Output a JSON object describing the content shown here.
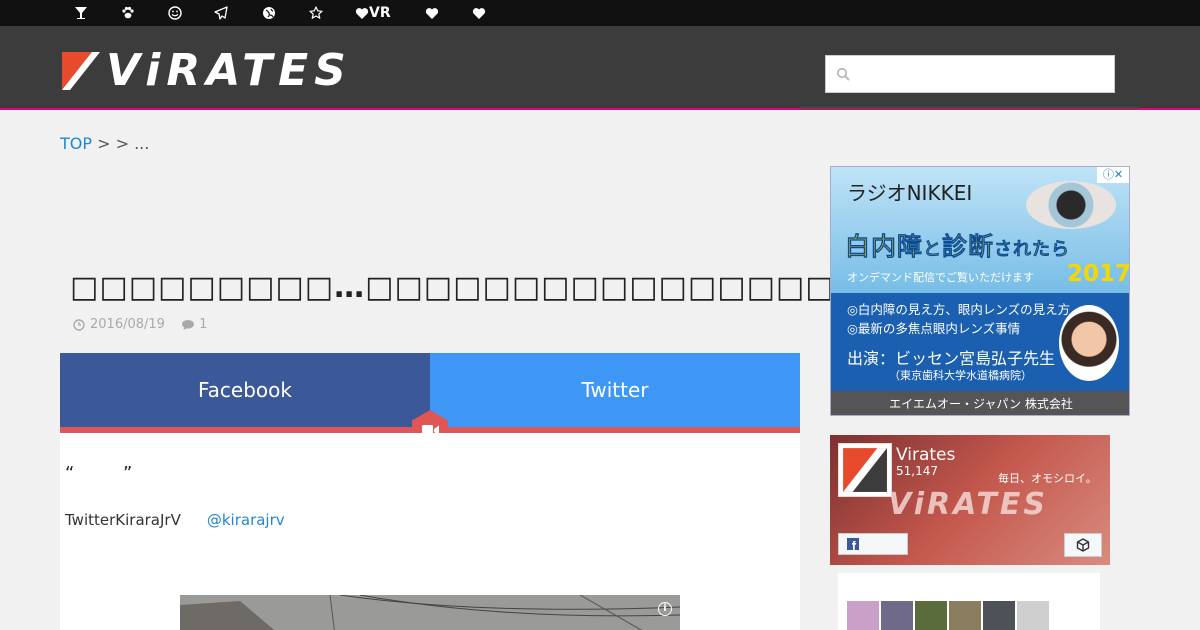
{
  "topbar": {
    "items": [
      {
        "icon": "cocktail-icon",
        "label": ""
      },
      {
        "icon": "paw-icon",
        "label": ""
      },
      {
        "icon": "smile-icon",
        "label": ""
      },
      {
        "icon": "paper-plane-icon",
        "label": ""
      },
      {
        "icon": "globe-icon",
        "label": ""
      },
      {
        "icon": "star-icon",
        "label": ""
      },
      {
        "icon": "heart-icon",
        "label": "VR"
      },
      {
        "icon": "heart-icon",
        "label": ""
      },
      {
        "icon": "heart-icon",
        "label": ""
      }
    ]
  },
  "header": {
    "logo_text": "ViRATES",
    "accent_color": "#e2007e",
    "search_placeholder": ""
  },
  "breadcrumb": {
    "top": "TOP",
    "sep1": " > ",
    "sep2": " > ...",
    "current": ""
  },
  "article": {
    "title": "□□□□□□□□□…□□□□□□□□□□□□□□□□□□□□□□□",
    "date": "2016/08/19",
    "comments": "1",
    "share": {
      "facebook": "Facebook",
      "twitter": "Twitter",
      "facebook_color": "#3b5898",
      "twitter_color": "#3e97f5"
    },
    "quote_open": "“",
    "quote_close": "”",
    "twitter_text": "TwitterKiraraJrV",
    "twitter_handle": "@kirarajrv"
  },
  "ad": {
    "radio": "ラジオNIKKEI",
    "headline_a": "白内障",
    "headline_b": "と",
    "headline_c": "診断",
    "headline_d": "されたら",
    "sub": "オンデマンド配信でご覧いただけます",
    "year": "2017",
    "line1": "◎白内障の見え方、眼内レンズの見え方",
    "line2": "◎最新の多焦点眼内レンズ事情",
    "line3": "出演：ビッセン宮島弘子先生",
    "line4": "（東京歯科大学水道橋病院）",
    "footer": "エイエムオー・ジャパン 株式会社",
    "choices": "ⓘ✕"
  },
  "fb_widget": {
    "page_name": "Virates",
    "likes": "51,147",
    "tagline": "毎日、オモシロイ。",
    "banner_text": "ViRATES"
  }
}
